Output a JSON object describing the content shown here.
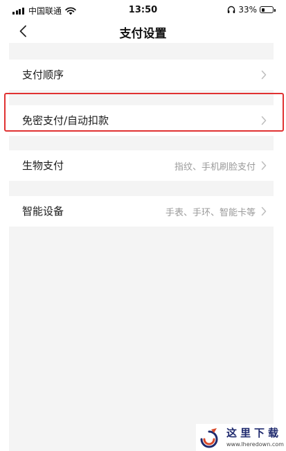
{
  "status_bar": {
    "carrier": "中国联通",
    "time": "13:50",
    "battery_pct": "33%",
    "battery_level": 0.33,
    "icons": [
      "signal-icon",
      "wifi-icon",
      "headphone-icon",
      "battery-icon"
    ]
  },
  "nav": {
    "back_icon": "chevron-left-icon",
    "title": "支付设置"
  },
  "settings": {
    "payment_order": {
      "label": "支付顺序",
      "value": ""
    },
    "password_free": {
      "label": "免密支付/自动扣款",
      "value": ""
    },
    "biometric": {
      "label": "生物支付",
      "value": "指纹、手机刷脸支付"
    },
    "smart_device": {
      "label": "智能设备",
      "value": "手表、手环、智能卡等"
    }
  },
  "highlight": {
    "color": "#e03131",
    "target": "password_free"
  },
  "watermark": {
    "text": "这里下载",
    "url": "www.lheredown.com"
  },
  "colors": {
    "background": "#f4f4f4",
    "row": "#ffffff",
    "secondary_text": "#9a9a9a",
    "chevron": "#bdbdbd"
  }
}
